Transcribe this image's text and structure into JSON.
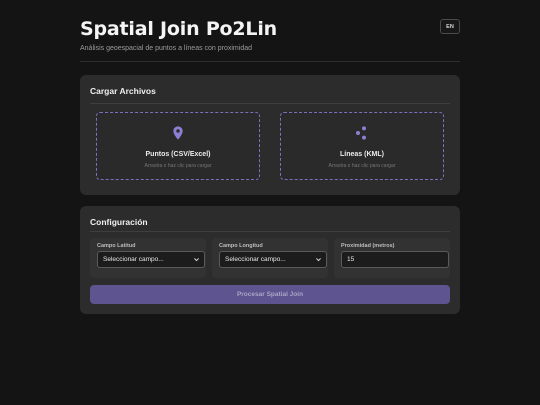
{
  "header": {
    "title": "Spatial Join Po2Lin",
    "subtitle": "Análisis geoespacial de puntos a líneas con proximidad",
    "lang_button": "EN"
  },
  "upload": {
    "title": "Cargar Archivos",
    "points": {
      "icon": "map-pin-icon",
      "label": "Puntos (CSV/Excel)",
      "hint": "Arrastra o haz clic para cargar"
    },
    "lines": {
      "icon": "network-nodes-icon",
      "label": "Líneas (KML)",
      "hint": "Arrastra o haz clic para cargar"
    }
  },
  "config": {
    "title": "Configuración",
    "lat_field": {
      "label": "Campo Latitud",
      "value": "Seleccionar campo..."
    },
    "lon_field": {
      "label": "Campo Longitud",
      "value": "Seleccionar campo..."
    },
    "proximity": {
      "label": "Proximidad (metros)",
      "value": "15"
    },
    "process_button": "Procesar Spatial Join"
  },
  "colors": {
    "accent": "#8b7fd4",
    "button": "#5d5490",
    "background": "#141414",
    "card": "#2c2c2c"
  }
}
